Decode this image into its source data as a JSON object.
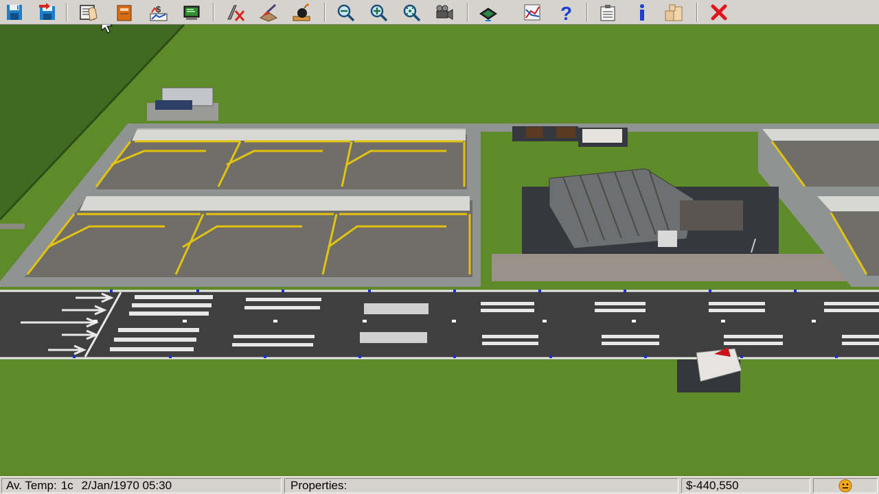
{
  "toolbar": {
    "buttons": [
      {
        "name": "save-button",
        "icon": "floppy-disk-icon"
      },
      {
        "name": "save-as-button",
        "icon": "floppy-arrow-icon"
      },
      {
        "name": "build-menu-button",
        "icon": "hand-grab-icon"
      },
      {
        "name": "orders-button",
        "icon": "notebook-icon"
      },
      {
        "name": "finances-button",
        "icon": "money-chart-icon"
      },
      {
        "name": "monitor-button",
        "icon": "computer-monitor-icon"
      },
      {
        "name": "remove-button",
        "icon": "scissors-x-icon"
      },
      {
        "name": "bulldoze-button",
        "icon": "shovel-icon"
      },
      {
        "name": "bomb-button",
        "icon": "bomb-icon"
      },
      {
        "name": "zoom-out-button",
        "icon": "zoom-out-icon"
      },
      {
        "name": "zoom-in-button",
        "icon": "zoom-in-icon"
      },
      {
        "name": "zoom-fit-button",
        "icon": "zoom-fit-icon"
      },
      {
        "name": "camera-button",
        "icon": "camera-icon"
      },
      {
        "name": "view-layer-button",
        "icon": "eye-layer-icon"
      },
      {
        "name": "graph-button",
        "icon": "graph-icon"
      },
      {
        "name": "help-button",
        "icon": "question-mark-icon"
      },
      {
        "name": "reports-button",
        "icon": "clipboard-icon"
      },
      {
        "name": "info-button",
        "icon": "info-icon"
      },
      {
        "name": "inventory-button",
        "icon": "boxes-icon"
      },
      {
        "name": "exit-button",
        "icon": "close-x-icon"
      }
    ]
  },
  "status": {
    "temp_label": "Av. Temp:",
    "temp_value": "1c",
    "datetime": "2/Jan/1970 05:30",
    "properties_label": "Properties:",
    "properties_value": "",
    "money": "$-440,550",
    "mood_icon": "smiley-face-icon"
  },
  "colors": {
    "grass": "#5f8a2a",
    "apron": "#6f6e68",
    "pavement": "#8f9493",
    "runway": "#3f3f3f",
    "stand_line": "#e3c30e",
    "toolbar": "#d6d3ce",
    "runway_marking": "#e8e8e8",
    "money_neg": "#000000"
  }
}
